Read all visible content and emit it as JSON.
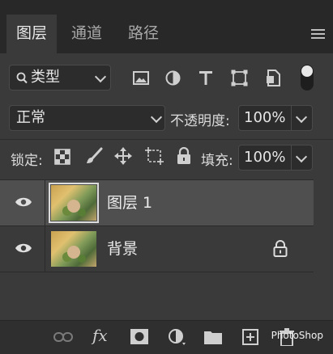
{
  "tabs": [
    {
      "label": "图层",
      "active": true
    },
    {
      "label": "通道",
      "active": false
    },
    {
      "label": "路径",
      "active": false
    }
  ],
  "filter": {
    "kind_label": "类型",
    "icons": [
      "search-icon",
      "image-filter-icon",
      "adjustment-filter-icon",
      "text-filter-icon",
      "shape-filter-icon",
      "smart-object-filter-icon",
      "filter-toggle-icon"
    ]
  },
  "blend": {
    "mode": "正常",
    "opacity_label": "不透明度:",
    "opacity_value": "100%"
  },
  "lock": {
    "label": "锁定:",
    "fill_label": "填充:",
    "fill_value": "100%",
    "icons": [
      "lock-transparent-pixels-icon",
      "lock-image-pixels-icon",
      "lock-position-icon",
      "lock-artboard-icon",
      "lock-all-icon"
    ]
  },
  "layers": [
    {
      "name": "图层 1",
      "selected": true,
      "locked": false
    },
    {
      "name": "背景",
      "selected": false,
      "locked": true
    }
  ],
  "footer": {
    "icons": [
      "link-layers-icon",
      "fx-icon",
      "add-mask-icon",
      "adjustment-layer-icon",
      "group-folder-icon",
      "new-layer-icon",
      "trash-icon"
    ],
    "fx_label": "fx",
    "watermark": "PhotoShop"
  },
  "colors": {
    "panel_bg": "#3a3a3a",
    "tab_bar_bg": "#282828",
    "selected_row": "#4f4f4f"
  }
}
